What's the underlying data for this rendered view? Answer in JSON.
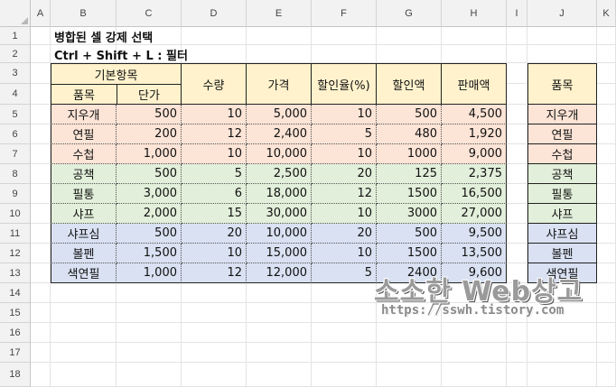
{
  "columns": [
    "A",
    "B",
    "C",
    "D",
    "E",
    "F",
    "G",
    "H",
    "I",
    "J",
    "K"
  ],
  "rows": [
    "1",
    "2",
    "3",
    "4",
    "5",
    "6",
    "7",
    "8",
    "9",
    "10",
    "11",
    "12",
    "13",
    "14",
    "15",
    "16",
    "17",
    "18"
  ],
  "titles": {
    "line1": "병합된 셀 강제 선택",
    "line2": "Ctrl + Shift + L : 필터"
  },
  "table": {
    "group_header": "기본항목",
    "sub_headers": [
      "품목",
      "단가"
    ],
    "headers": [
      "수량",
      "가격",
      "할인율(%)",
      "할인액",
      "판매액"
    ],
    "rows": [
      [
        "지우개",
        "500",
        "10",
        "5,000",
        "10",
        "500",
        "4,500"
      ],
      [
        "연필",
        "200",
        "12",
        "2,400",
        "5",
        "480",
        "1,920"
      ],
      [
        "수첩",
        "1,000",
        "10",
        "10,000",
        "10",
        "1000",
        "9,000"
      ],
      [
        "공책",
        "500",
        "5",
        "2,500",
        "20",
        "125",
        "2,375"
      ],
      [
        "필통",
        "3,000",
        "6",
        "18,000",
        "12",
        "1500",
        "16,500"
      ],
      [
        "샤프",
        "2,000",
        "15",
        "30,000",
        "10",
        "3000",
        "27,000"
      ],
      [
        "샤프심",
        "500",
        "20",
        "10,000",
        "20",
        "500",
        "9,500"
      ],
      [
        "볼펜",
        "1,500",
        "10",
        "15,000",
        "10",
        "1500",
        "13,500"
      ],
      [
        "색연필",
        "1,000",
        "12",
        "12,000",
        "5",
        "2400",
        "9,600"
      ]
    ],
    "row_colors": [
      "#fce4d6",
      "#fce4d6",
      "#fce4d6",
      "#e2efda",
      "#e2efda",
      "#e2efda",
      "#d9e1f2",
      "#d9e1f2",
      "#d9e1f2"
    ],
    "header_color": "#fff2cc"
  },
  "side_list": {
    "header": "품목",
    "items": [
      "지우개",
      "연필",
      "수첩",
      "공책",
      "필통",
      "샤프",
      "샤프심",
      "볼펜",
      "색연필"
    ]
  },
  "watermark": {
    "line1": "소소한 Web상고",
    "line2": "https://sswh.tistory.com"
  }
}
